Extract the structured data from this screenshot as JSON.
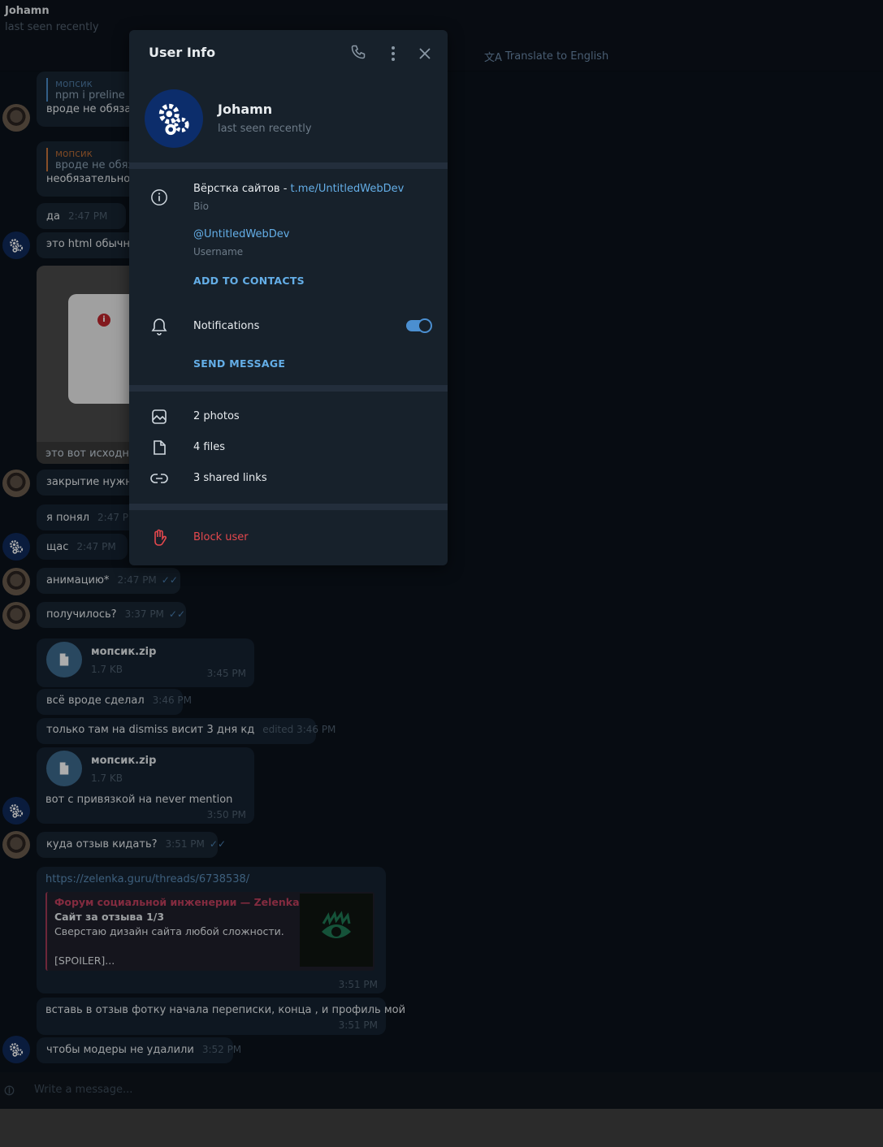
{
  "header": {
    "name": "Johamn",
    "status": "last seen recently",
    "translate": "Translate to English"
  },
  "messages": {
    "m1": {
      "qname": "мопсик",
      "qtext": "npm i preline",
      "text": "вроде не обязате"
    },
    "m2": {
      "qname": "мопсик",
      "qtext": "вроде не обяза",
      "text": "необязательно"
    },
    "m3": {
      "text": "да",
      "time": "2:47 PM"
    },
    "m4": {
      "text": "это html обычны"
    },
    "m5": {
      "text": "это вот исходник"
    },
    "m6": {
      "text": "закрытие нужно"
    },
    "m7": {
      "text": "я понял",
      "time": "2:47 PM"
    },
    "m8": {
      "text": "щас",
      "time": "2:47 PM"
    },
    "m9": {
      "text": "анимацию*",
      "time": "2:47 PM"
    },
    "m10": {
      "text": "получилось?",
      "time": "3:37 PM"
    },
    "m11": {
      "file": "мопсик.zip",
      "size": "1.7 KB",
      "time": "3:45 PM"
    },
    "m12": {
      "text": "всё вроде сделал",
      "time": "3:46 PM"
    },
    "m13": {
      "text": "только там на dismiss висит 3 дня кд",
      "time": "edited 3:46 PM"
    },
    "m14": {
      "file": "мопсик.zip",
      "size": "1.7 KB",
      "text": "вот с привязкой на never mention",
      "time": "3:50 PM"
    },
    "m15": {
      "text": "куда отзыв кидать?",
      "time": "3:51 PM"
    },
    "m16": {
      "url": "https://zelenka.guru/threads/6738538/",
      "site": "Форум социальной инженерии — Zelenka....",
      "title": "Сайт за отзыва 1/3",
      "desc": "Сверстаю дизайн сайта любой сложности.",
      "spoiler": "[SPOILER]...",
      "time": "3:51 PM"
    },
    "m17": {
      "text": "вставь в отзыв фотку начала переписки, конца , и профиль мой",
      "time": "3:51 PM"
    },
    "m18": {
      "text": "чтобы модеры не удалили",
      "time": "3:52 PM"
    }
  },
  "composer": {
    "placeholder": "Write a message..."
  },
  "panel": {
    "title": "User Info",
    "name": "Johamn",
    "status": "last seen recently",
    "bio_text": "Вёрстка сайтов - ",
    "bio_link": "t.me/UntitledWebDev",
    "bio_label": "Bio",
    "username": "@UntitledWebDev",
    "username_label": "Username",
    "add_contacts": "ADD TO CONTACTS",
    "notifications": "Notifications",
    "notifications_on": true,
    "send_message": "SEND MESSAGE",
    "photos": "2 photos",
    "files": "4 files",
    "links": "3 shared links",
    "block": "Block user"
  },
  "colors": {
    "accent": "#64aee7",
    "danger": "#e5484d",
    "panel_bg": "#17212b",
    "chat_bg": "#0e1621",
    "bubble": "#182533"
  }
}
